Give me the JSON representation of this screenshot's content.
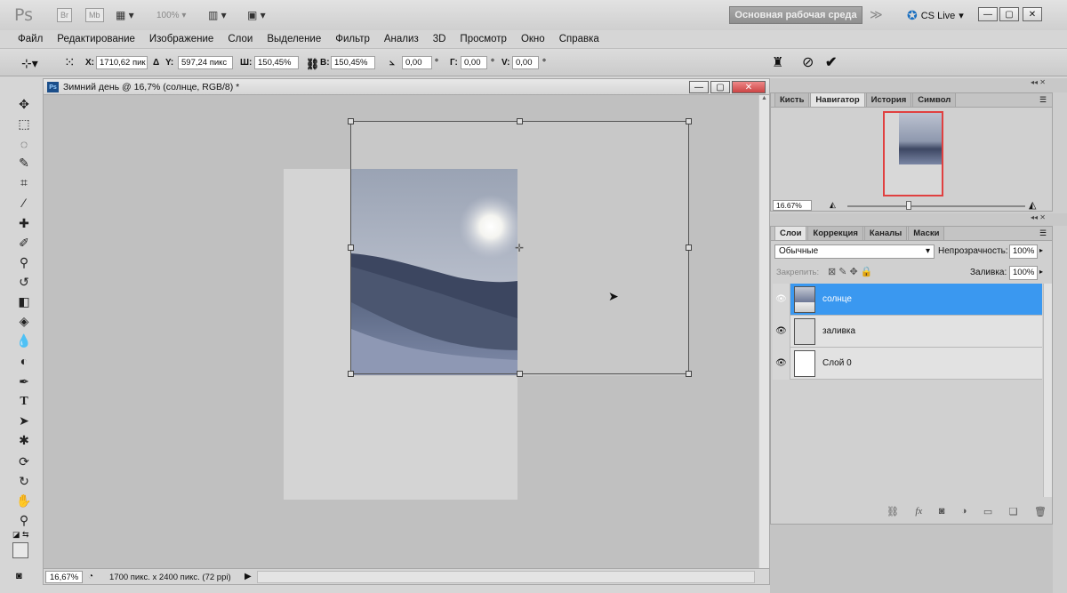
{
  "app": {
    "logo": "Ps",
    "bridge": "Br",
    "minibridge": "Mb",
    "zoom_select": "100%",
    "workspace": "Основная рабочая среда",
    "cs_live": "CS Live"
  },
  "menu": [
    "Файл",
    "Редактирование",
    "Изображение",
    "Слои",
    "Выделение",
    "Фильтр",
    "Анализ",
    "3D",
    "Просмотр",
    "Окно",
    "Справка"
  ],
  "options": {
    "x_label": "X:",
    "x_value": "1710,62 пик",
    "delta": "Δ",
    "y_label": "Y:",
    "y_value": "597,24 пикс",
    "w_label": "Ш:",
    "w_value": "150,45%",
    "h_label": "В:",
    "h_value": "150,45%",
    "angle_value": "0,00",
    "angle_unit": "°",
    "g_label": "Г:",
    "g_value": "0,00",
    "v_label": "V:",
    "v_value": "0,00",
    "deg1": "°",
    "deg2": "°"
  },
  "document": {
    "title": "Зимний день @ 16,7% (солнце, RGB/8) *",
    "zoom": "16,67%",
    "info": "1700 пикс. x 2400 пикс. (72 ppi)"
  },
  "navigator": {
    "tabs": [
      "Кисть",
      "Навигатор",
      "История",
      "Символ"
    ],
    "active_tab": 1,
    "zoom": "16.67%"
  },
  "layers_panel": {
    "tabs": [
      "Слои",
      "Коррекция",
      "Каналы",
      "Маски"
    ],
    "active_tab": 0,
    "blend_mode": "Обычные",
    "opacity_label": "Непрозрачность:",
    "opacity": "100%",
    "lock_label": "Закрепить:",
    "fill_label": "Заливка:",
    "fill": "100%",
    "layers": [
      {
        "name": "солнце",
        "selected": true
      },
      {
        "name": "заливка",
        "selected": false
      },
      {
        "name": "Слой 0",
        "selected": false
      }
    ]
  },
  "colors": {
    "selection": "#3a98f0",
    "nav_frame": "#e04040"
  }
}
